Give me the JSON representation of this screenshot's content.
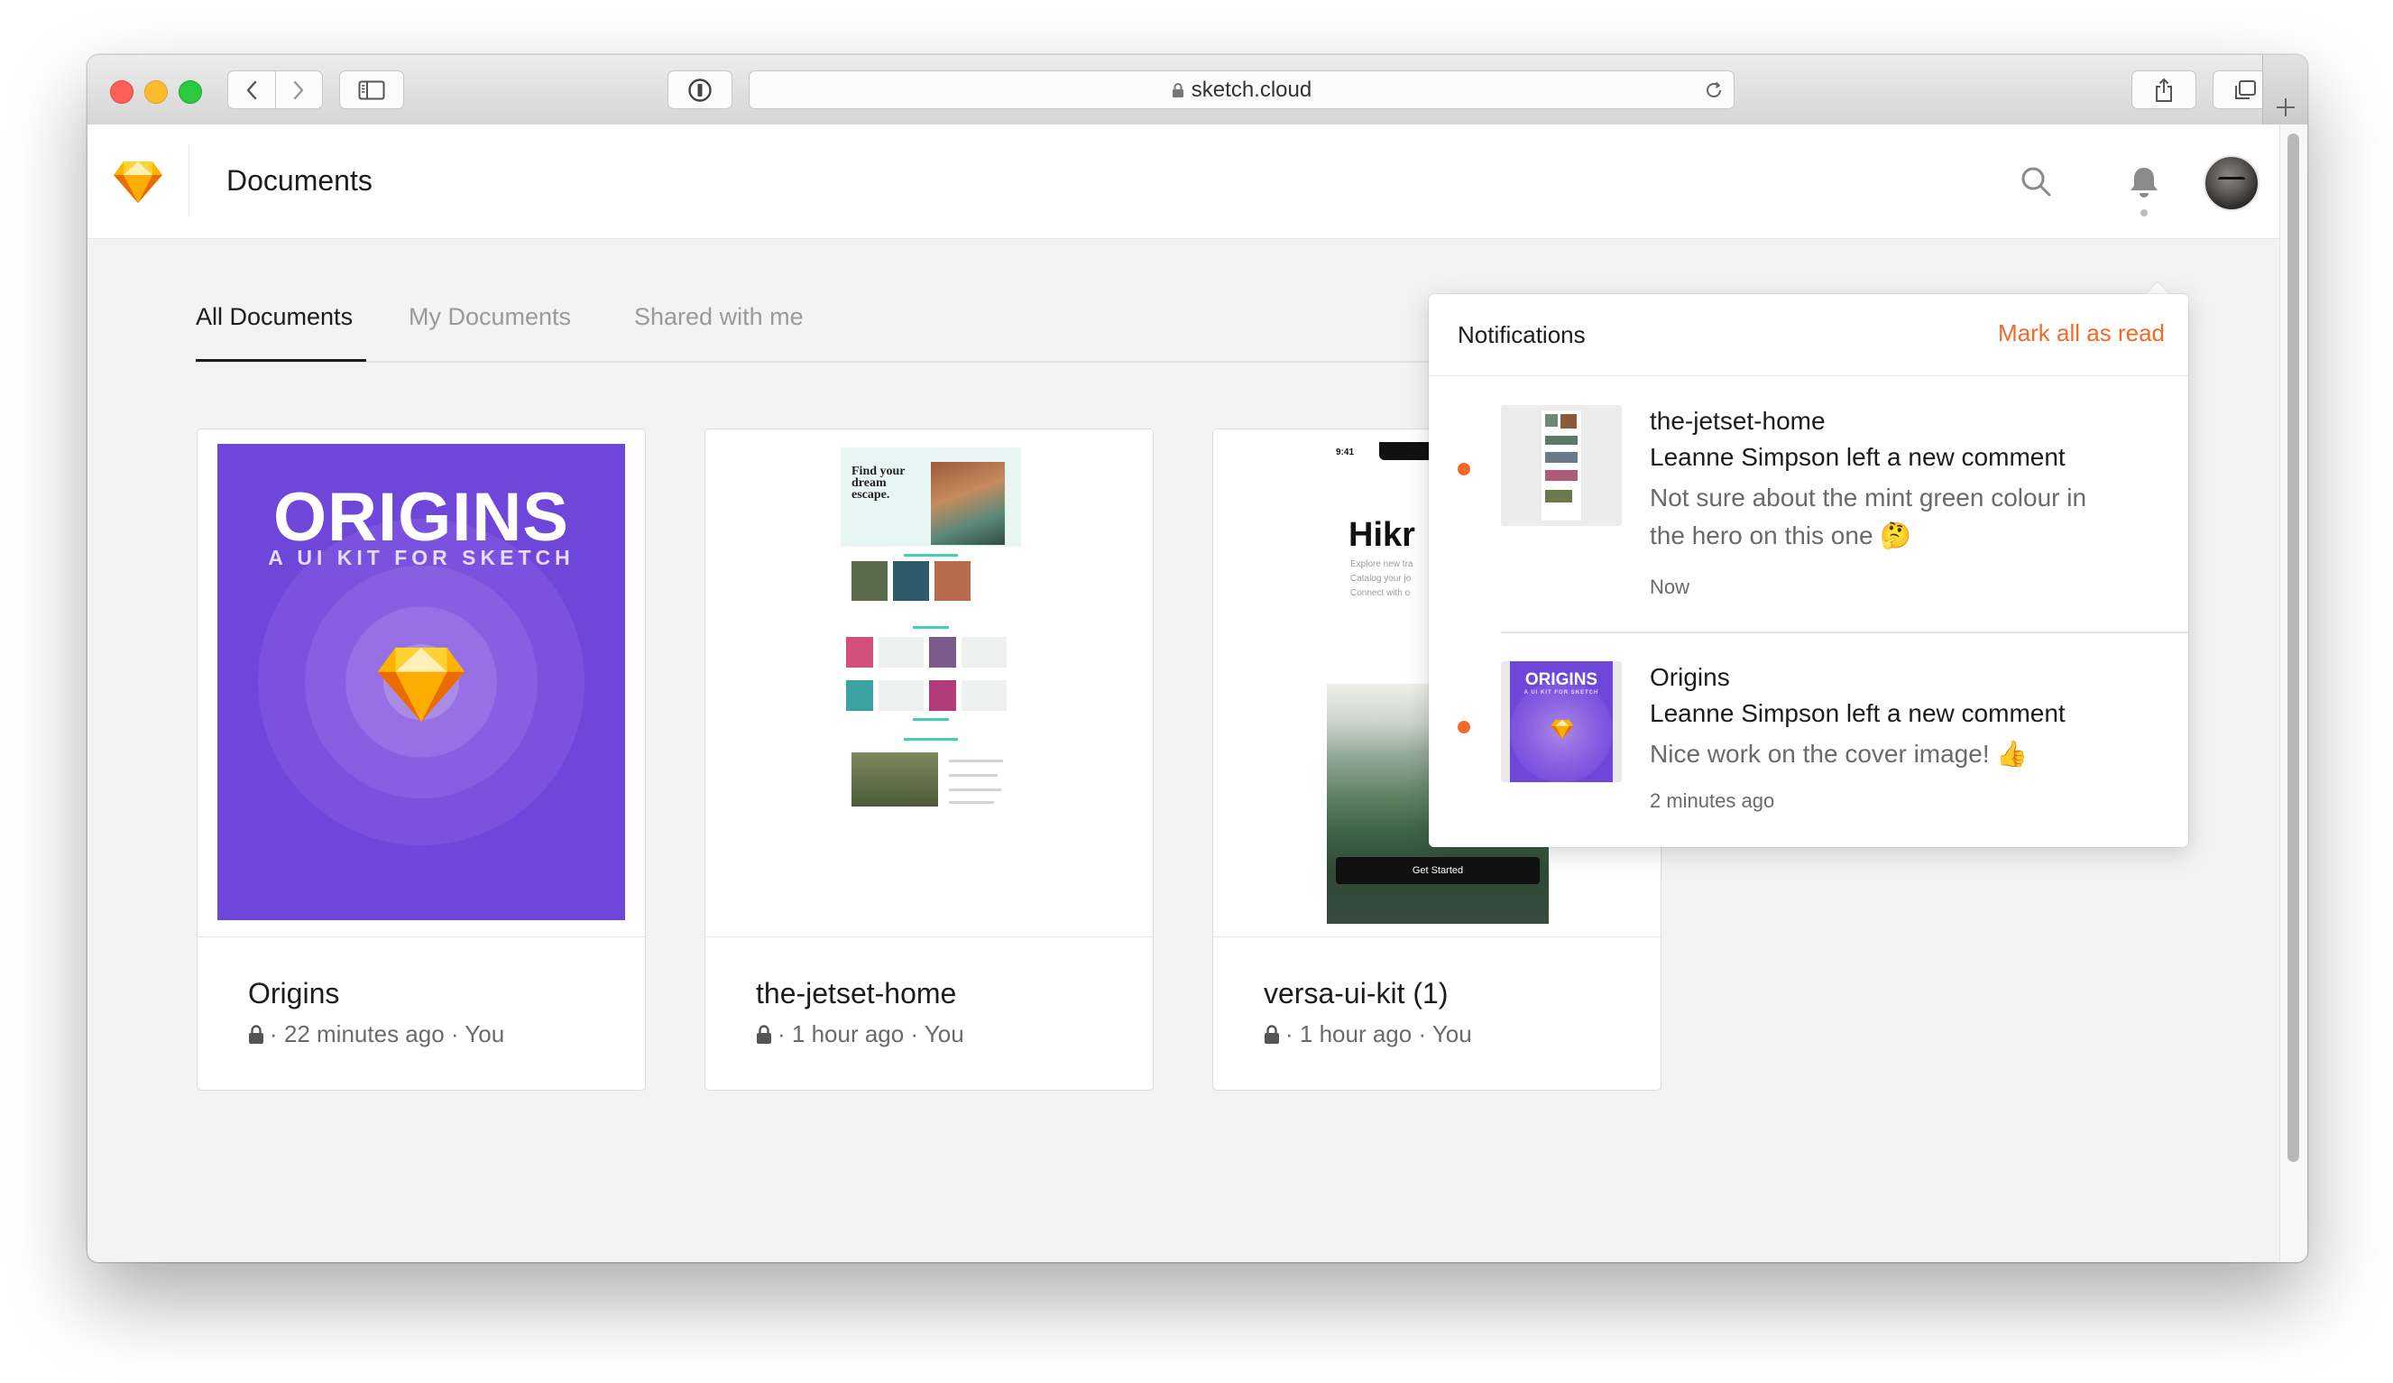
{
  "browser": {
    "url": "sketch.cloud"
  },
  "app": {
    "title": "Documents"
  },
  "tabs": [
    {
      "label": "All Documents",
      "active": true
    },
    {
      "label": "My Documents",
      "active": false
    },
    {
      "label": "Shared with me",
      "active": false
    }
  ],
  "documents": [
    {
      "name": "Origins",
      "meta": "· 22 minutes ago · You",
      "cover": {
        "title": "ORIGINS",
        "subtitle": "A UI KIT FOR SKETCH"
      }
    },
    {
      "name": "the-jetset-home",
      "meta": "· 1 hour ago · You",
      "preview": {
        "headline": "Find your dream escape."
      }
    },
    {
      "name": "versa-ui-kit (1)",
      "meta": "· 1 hour ago · You",
      "preview": {
        "time": "9:41",
        "app_name": "Hikr",
        "lines": [
          "Explore new tra",
          "Catalog your jo",
          "Connect with o"
        ],
        "button": "Get Started"
      }
    }
  ],
  "notifications": {
    "title": "Notifications",
    "mark_all": "Mark all as read",
    "items": [
      {
        "document": "the-jetset-home",
        "action": "Leanne Simpson left a new comment",
        "comment": "Not sure about the mint green colour in the hero on this one 🤔",
        "time": "Now",
        "unread": true
      },
      {
        "document": "Origins",
        "action": "Leanne Simpson left a new comment",
        "comment": "Nice work on the cover image! 👍",
        "time": "2 minutes ago",
        "unread": true,
        "thumb": {
          "title": "ORIGINS",
          "subtitle": "A UI KIT FOR SKETCH"
        }
      }
    ]
  },
  "colors": {
    "accent": "#f26a26",
    "origins_purple": "#6f46da",
    "sketch_orange": "#fdad00"
  }
}
